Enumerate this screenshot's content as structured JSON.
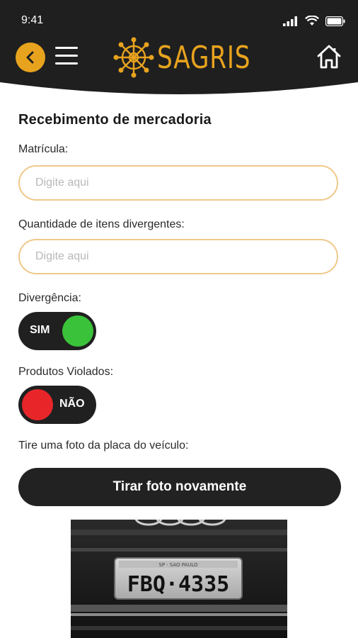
{
  "status_bar": {
    "time": "9:41"
  },
  "header": {
    "brand": "SAGRIS",
    "brand_color": "#e8a31e"
  },
  "page": {
    "title": "Recebimento de mercadoria"
  },
  "form": {
    "registration": {
      "label": "Matrícula:",
      "placeholder": "Digite aqui"
    },
    "divergent_qty": {
      "label": "Quantidade de itens divergentes:",
      "placeholder": "Digite aqui"
    },
    "divergence": {
      "label": "Divergência:",
      "state": "SIM",
      "knob_color": "#3ac33a"
    },
    "violated_products": {
      "label": "Produtos Violados:",
      "state": "NÃO",
      "knob_color": "#e8262a"
    },
    "photo": {
      "label": "Tire uma foto da placa do veículo:",
      "button": "Tirar foto novamente"
    }
  },
  "plate": {
    "top_text": "SP · SAO PAULO",
    "number": "FBQ·4335"
  },
  "icons": [
    "chevron-left-icon",
    "menu-icon",
    "logo-wheel-icon",
    "home-icon",
    "signal-icon",
    "wifi-icon",
    "battery-icon"
  ]
}
